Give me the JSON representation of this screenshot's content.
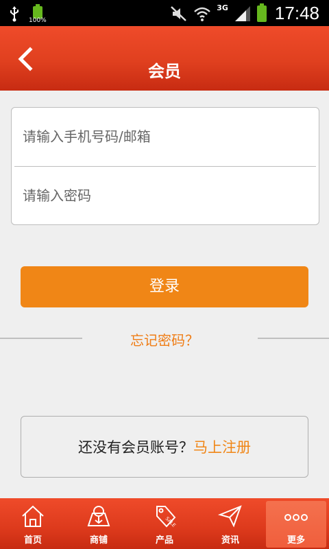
{
  "status_bar": {
    "battery_small_label": "100%",
    "network": "3G",
    "time": "17:48"
  },
  "header": {
    "title": "会员"
  },
  "form": {
    "account_placeholder": "请输入手机号码/邮箱",
    "password_placeholder": "请输入密码"
  },
  "login_label": "登录",
  "forgot_label": "忘记密码？",
  "register": {
    "prompt": "还没有会员账号？",
    "link": "马上注册"
  },
  "tabs": [
    {
      "label": "首页",
      "icon": "home-icon"
    },
    {
      "label": "商铺",
      "icon": "shop-icon"
    },
    {
      "label": "产品",
      "icon": "sale-tag-icon"
    },
    {
      "label": "资讯",
      "icon": "paper-plane-icon"
    },
    {
      "label": "更多",
      "icon": "more-dots-icon",
      "active": true
    }
  ],
  "colors": {
    "accent_red": "#e0401f",
    "button_orange": "#f08616",
    "link_orange": "#ef7d16"
  }
}
